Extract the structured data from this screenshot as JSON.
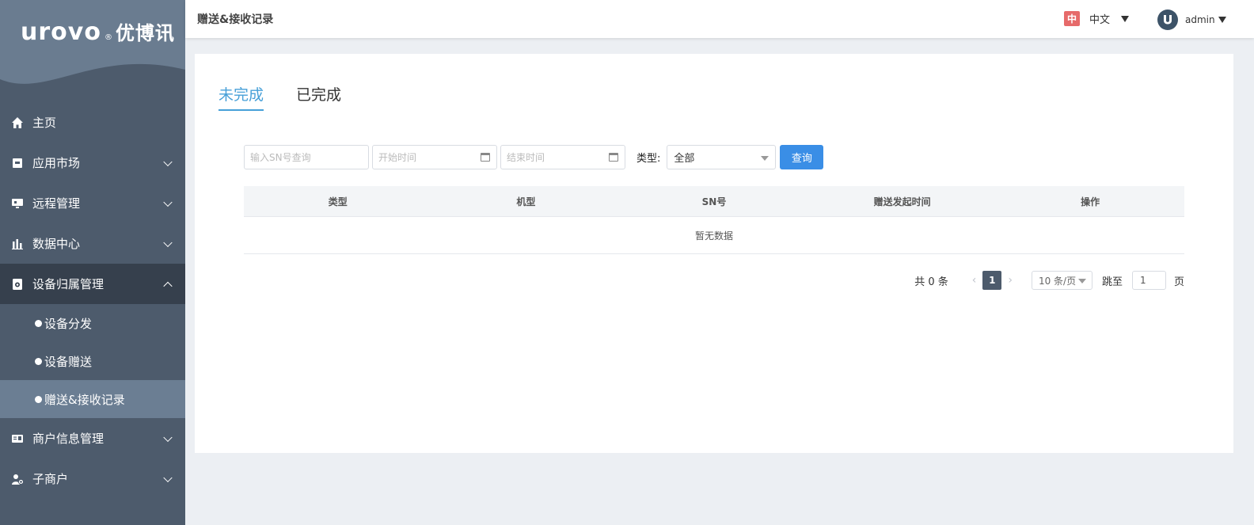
{
  "brand": {
    "latin": "urovo",
    "mark": "®",
    "chinese": "优博讯"
  },
  "header": {
    "title": "赠送&接收记录"
  },
  "language": {
    "flag": "中",
    "label": "中文"
  },
  "user": {
    "name": "admin"
  },
  "sidebar": {
    "items": [
      {
        "label": "主页",
        "icon": "home-icon"
      },
      {
        "label": "应用市场",
        "icon": "app-store-icon"
      },
      {
        "label": "远程管理",
        "icon": "remote-icon"
      },
      {
        "label": "数据中心",
        "icon": "chart-icon"
      },
      {
        "label": "设备归属管理",
        "icon": "device-icon"
      },
      {
        "label": "商户信息管理",
        "icon": "id-card-icon"
      },
      {
        "label": "子商户",
        "icon": "user-add-icon"
      }
    ],
    "sub_items": [
      {
        "label": "设备分发"
      },
      {
        "label": "设备赠送"
      },
      {
        "label": "赠送&接收记录"
      }
    ]
  },
  "tabs": [
    {
      "label": "未完成",
      "active": true
    },
    {
      "label": "已完成",
      "active": false
    }
  ],
  "filters": {
    "sn_placeholder": "输入SN号查询",
    "start_placeholder": "开始时间",
    "end_placeholder": "结束时间",
    "type_label": "类型:",
    "type_value": "全部",
    "query_button": "查询"
  },
  "table": {
    "columns": [
      "类型",
      "机型",
      "SN号",
      "赠送发起时间",
      "操作"
    ],
    "empty_text": "暂无数据"
  },
  "pagination": {
    "total": "共 0 条",
    "current_page": "1",
    "page_size": "10 条/页",
    "goto_label": "跳至",
    "goto_value": "1",
    "page_suffix": "页"
  },
  "colors": {
    "sidebar_bg": "#4d5b6c",
    "accent": "#47a0d8",
    "button": "#3a8ee6"
  }
}
